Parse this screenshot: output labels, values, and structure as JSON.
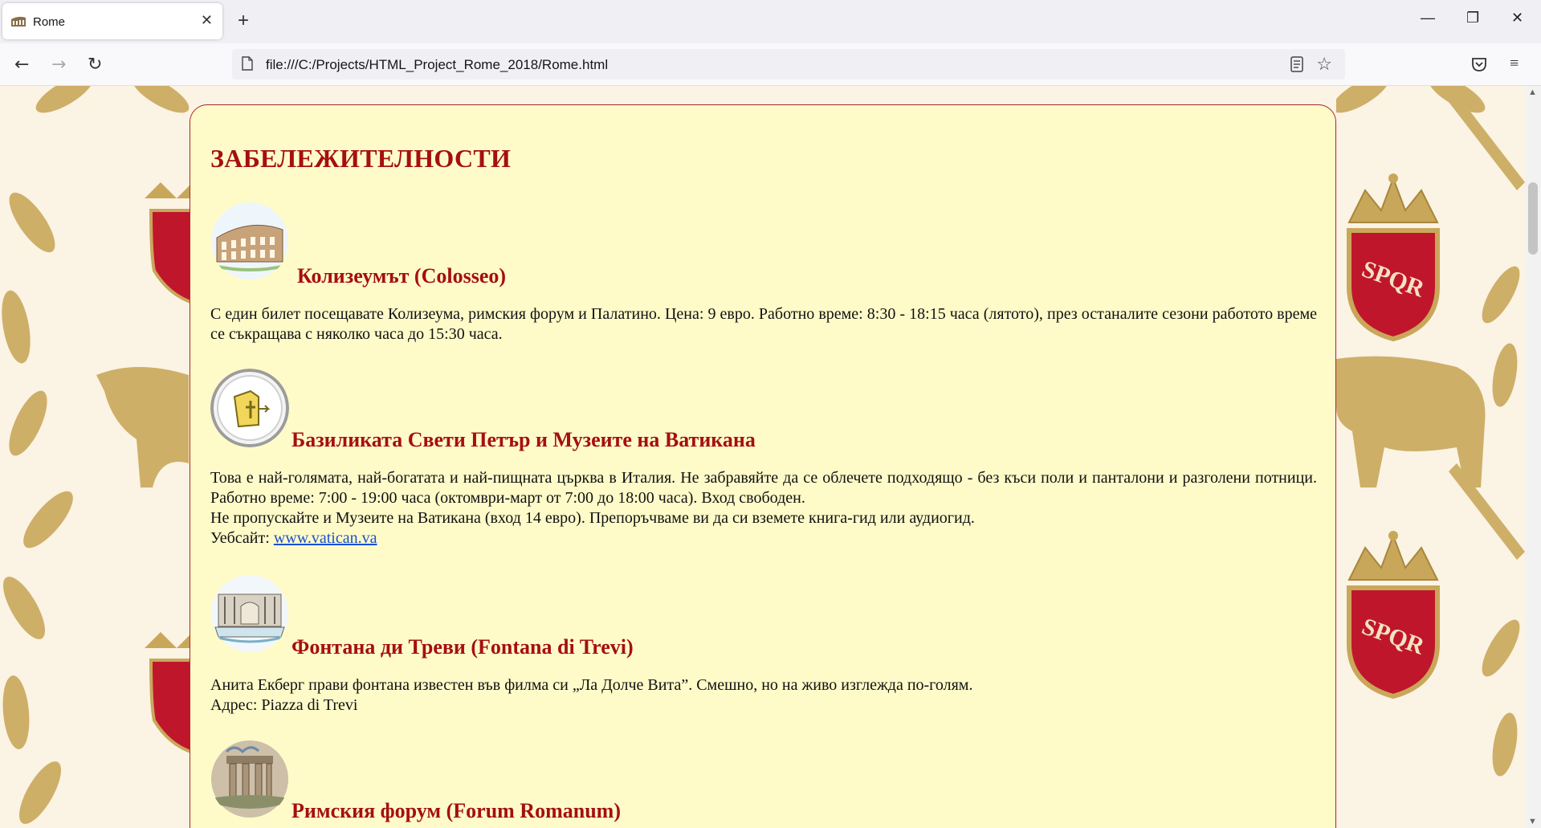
{
  "browser": {
    "tab_title": "Rome",
    "url": "file:///C:/Projects/HTML_Project_Rome_2018/Rome.html"
  },
  "page": {
    "heading": "ЗАБЕЛЕЖИТЕЛНОСТИ",
    "sights": [
      {
        "title": "Колизеумът (Colosseo)",
        "lines": [
          "С един билет посещавате Колизеума, римския форум и Палатино. Цена: 9 евро. Работно време: 8:30 - 18:15 часа (лятото), през останалите сезони работото време се съкращава с няколко часа до 15:30 часа."
        ]
      },
      {
        "title": "Базиликата Свети Петър и Музеите на Ватикана",
        "lines": [
          "Това е най-голямата, най-богатата и най-пищната църква в Италия. Не забравяйте да се облечете подходящо - без къси поли и панталони и разголени потници. Работно време: 7:00 - 19:00 часа (октомври-март от 7:00 до 18:00 часа). Вход свободен.",
          "Не пропускайте и Музеите на Ватикана (вход 14 евро). Препоръчваме ви да си вземете книга-гид или аудиогид."
        ],
        "website_label": "Уебсайт: ",
        "website_link": "www.vatican.va"
      },
      {
        "title": "Фонтана ди Треви (Fontana di Trevi)",
        "lines": [
          "Анита Екберг прави фонтана известен във филма си „Ла Долче Вита”. Смешно, но на живо изглежда по-голям.",
          "Адрес: Piazza di Trevi"
        ]
      },
      {
        "title": "Римския форум (Forum Romanum)",
        "lines": []
      }
    ]
  },
  "background_emblem_text": "SPQR",
  "colors": {
    "heading": "#a50f0f",
    "content_background": "#fefbc9",
    "content_border": "#a8242c",
    "gold": "#c9a75a",
    "shield_red": "#c0162c",
    "link": "#1a4fd0"
  },
  "icons": {
    "back": "arrow-left-icon",
    "forward": "arrow-right-icon",
    "reload": "reload-icon",
    "reader": "reader-view-icon",
    "bookmark": "star-icon",
    "pocket": "pocket-icon",
    "menu": "hamburger-menu-icon"
  }
}
